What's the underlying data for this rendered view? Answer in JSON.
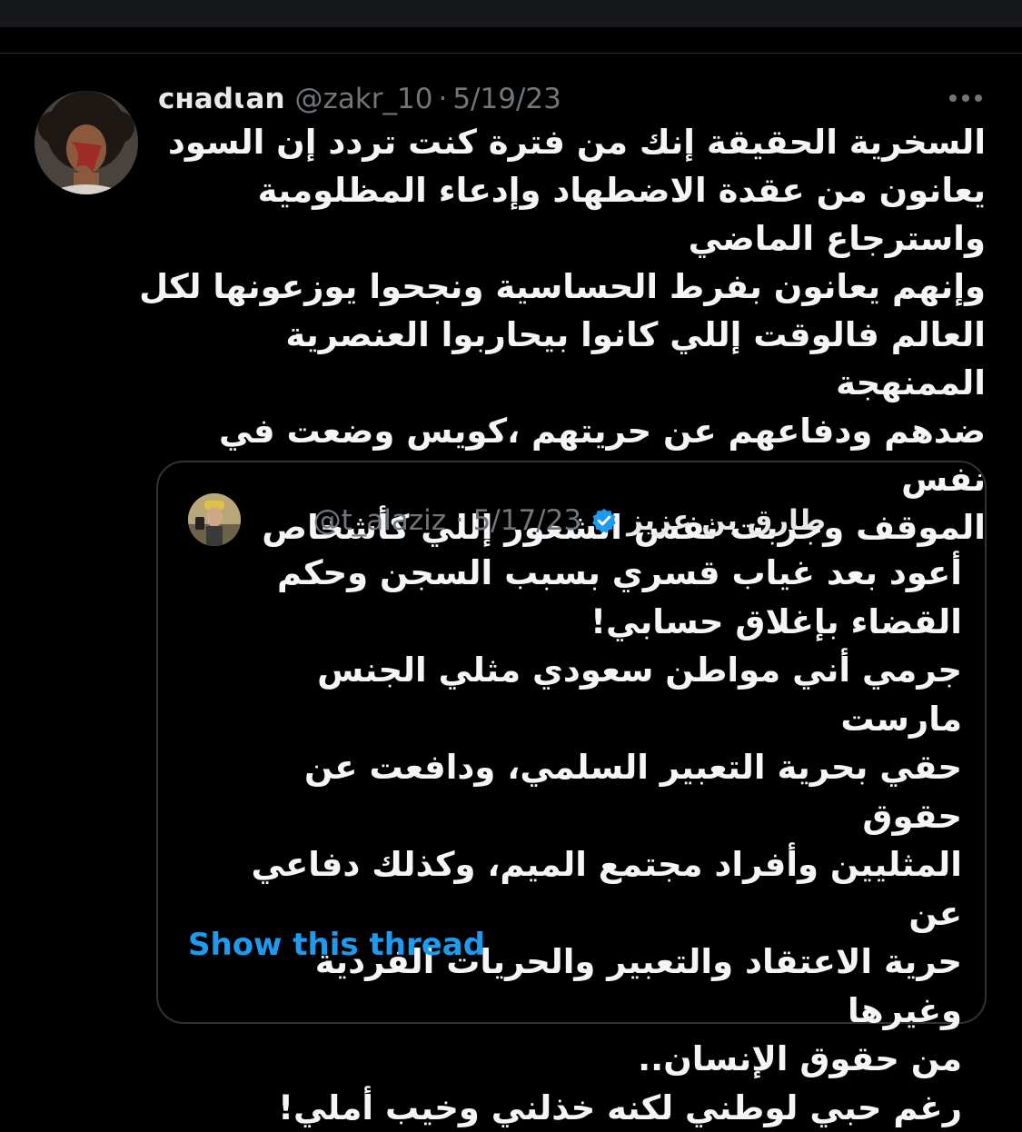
{
  "tweet": {
    "display_name": "cʜadɩan",
    "handle": "@zakr_10",
    "separator": "·",
    "date": "5/19/23",
    "more_icon": "more-horizontal-icon",
    "text": "السخرية الحقيقة إنك من فترة كنت تردد إن السود\nيعانون من عقدة الاضطهاد وإدعاء المظلومية\nواسترجاع الماضي\nوإنهم يعانون بفرط الحساسية ونجحوا يوزعونها لكل\nالعالم فالوقت إللي كانوا بيحاربوا العنصرية الممنهجة\nضدهم ودفاعهم عن حريتهم ،كويس وضعت في نفس\nالموقف وجربت نفس الشعور إللي كأشخاص"
  },
  "quoted_tweet": {
    "display_name": "طارق بن عزيز",
    "verified_icon": "verified-badge-icon",
    "handle": "@t_alaziz",
    "separator": "·",
    "date": "5/17/23",
    "text": "أعود بعد غياب قسري بسبب السجن وحكم\nالقضاء بإغلاق حسابي!\nجرمي أني مواطن سعودي مثلي الجنس مارست\nحقي بحرية التعبير السلمي، ودافعت عن حقوق\nالمثليين وأفراد مجتمع الميم، وكذلك دفاعي عن\nحرية الاعتقاد والتعبير والحريات الفردية وغيرها\nمن حقوق الإنسان..\nرغم حبي لوطني لكنه خذلني وخيب أملي!",
    "show_thread_label": "Show this thread"
  },
  "colors": {
    "background": "#000000",
    "text": "#e7e9ea",
    "muted": "#71767b",
    "link": "#1d9bf0",
    "border": "#2f3336",
    "verified": "#1d9bf0"
  }
}
